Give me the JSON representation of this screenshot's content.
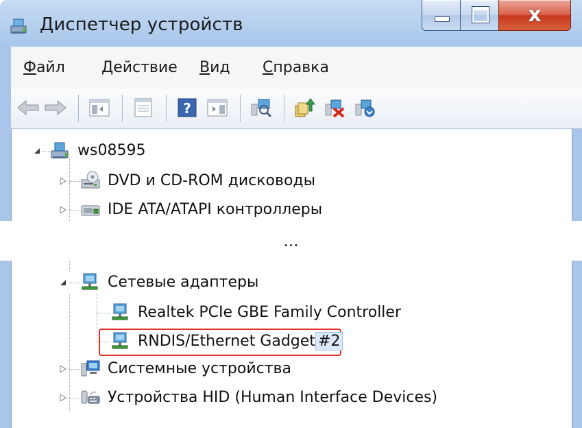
{
  "window": {
    "title": "Диспетчер устройств",
    "menu": [
      {
        "label": "Файл",
        "accel": "Ф",
        "rest": "айл"
      },
      {
        "label": "Действие",
        "accel": "Д",
        "rest": "ействие"
      },
      {
        "label": "Вид",
        "accel": "В",
        "rest": "ид"
      },
      {
        "label": "Справка",
        "accel": "С",
        "rest": "правка"
      }
    ],
    "toolbar_icons": [
      "back-icon",
      "forward-icon",
      "console-tree-icon",
      "properties-icon",
      "help-icon",
      "action-pane-icon",
      "scan-hardware-icon",
      "update-driver-icon",
      "disable-device-icon",
      "uninstall-device-icon"
    ]
  },
  "tree_top": {
    "root": "ws08595",
    "items": [
      "DVD и CD-ROM дисководы",
      "IDE ATA/ATAPI контроллеры"
    ]
  },
  "ellipsis": "…",
  "tree_bottom": {
    "network_group": "Сетевые адаптеры",
    "network_children": [
      {
        "name": "Realtek PCIe GBE Family Controller"
      },
      {
        "name": "RNDIS/Ethernet Gadget",
        "suffix": "#2"
      }
    ],
    "items": [
      "Системные устройства",
      "Устройства HID (Human Interface Devices)"
    ]
  },
  "colors": {
    "title_bar": "#b5cfee",
    "close_button": "#c7381e",
    "highlight_box": "#e0322c",
    "selection": "#dbe9fb"
  }
}
